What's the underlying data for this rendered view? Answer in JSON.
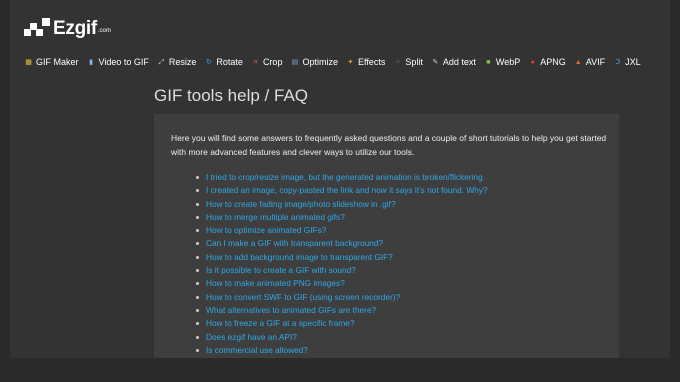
{
  "header": {
    "logo_text": "Ezgif",
    "logo_suffix": ".com"
  },
  "nav": {
    "items": [
      {
        "label": "GIF Maker",
        "icon": "gif-maker-icon",
        "color": "#e8c03a"
      },
      {
        "label": "Video to GIF",
        "icon": "video-icon",
        "color": "#8ab4f8"
      },
      {
        "label": "Resize",
        "icon": "resize-icon",
        "color": "#9fd2f5"
      },
      {
        "label": "Rotate",
        "icon": "rotate-icon",
        "color": "#3b9be8"
      },
      {
        "label": "Crop",
        "icon": "crop-icon",
        "color": "#e06a4a"
      },
      {
        "label": "Optimize",
        "icon": "optimize-icon",
        "color": "#7aa6d8"
      },
      {
        "label": "Effects",
        "icon": "effects-icon",
        "color": "#e8a23a"
      },
      {
        "label": "Split",
        "icon": "split-icon",
        "color": "#6bb0ef"
      },
      {
        "label": "Add text",
        "icon": "add-text-icon",
        "color": "#cccccc"
      },
      {
        "label": "WebP",
        "icon": "webp-icon",
        "color": "#7ac943"
      },
      {
        "label": "APNG",
        "icon": "apng-icon",
        "color": "#e23b3b"
      },
      {
        "label": "AVIF",
        "icon": "avif-icon",
        "color": "#e8672f"
      },
      {
        "label": "JXL",
        "icon": "jxl-icon",
        "color": "#5ab4e6"
      }
    ]
  },
  "main": {
    "title": "GIF tools help / FAQ",
    "intro": "Here you will find some answers to frequently asked questions and a couple of short tutorials to help you get started with more advanced features and clever ways to utilize our tools.",
    "faq": [
      "I tried to crop/resize image, but the generated animation is broken/flickering",
      "I created an image, copy-pasted the link and now it says it's not found. Why?",
      "How to create fading image/photo slideshow in .gif?",
      "How to merge multiple animated gifs?",
      "How to optimize animated GIFs?",
      "Can I make a GIF with transparent background?",
      "How to add background image to transparent GIF?",
      "Is it possible to create a GIF with sound?",
      "How to make animated PNG images?",
      "How to convert SWF to GIF (using screen recorder)?",
      "What alternatives to animated GIFs are there?",
      "How to freeze a GIF at a specific frame?",
      "Does ezgif have an API?",
      "Is commercial use allowed?"
    ]
  },
  "colors": {
    "background": "#2a2a2a",
    "page": "#333333",
    "content_box": "#3e3e3e",
    "link": "#2fa8e8",
    "text": "#eeeeee"
  }
}
